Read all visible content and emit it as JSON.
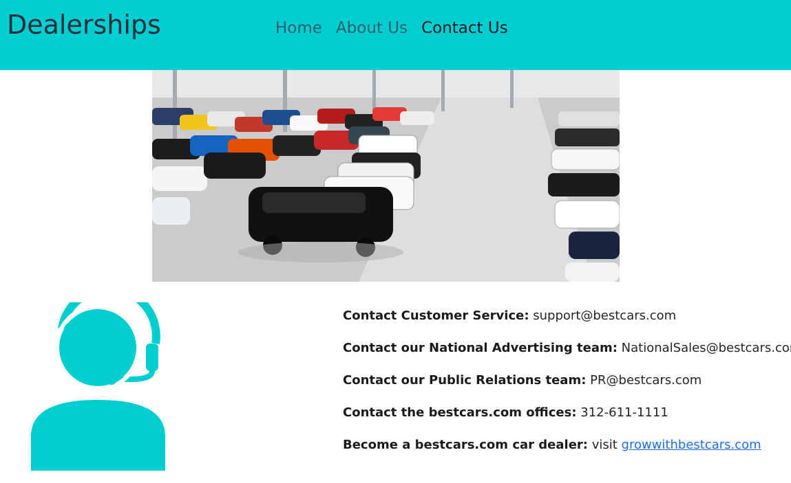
{
  "navbar": {
    "brand": "Dealerships",
    "links": [
      {
        "label": "Home",
        "active": false
      },
      {
        "label": "About Us",
        "active": false
      },
      {
        "label": "Contact Us",
        "active": true
      }
    ],
    "background_color": "#00ced1"
  },
  "hero": {
    "description": "Indoor car dealership lot photograph"
  },
  "support_icon": {
    "name": "customer-support-headset-icon",
    "color": "#00ced1"
  },
  "contacts": [
    {
      "label": "Contact Customer Service:",
      "value": "support@bestcars.com"
    },
    {
      "label": "Contact our National Advertising team:",
      "value": "NationalSales@bestcars.com"
    },
    {
      "label": "Contact our Public Relations team:",
      "value": "PR@bestcars.com"
    },
    {
      "label": "Contact the bestcars.com offices:",
      "value": "312-611-1111"
    },
    {
      "label": "Become a bestcars.com car dealer:",
      "value": "visit",
      "link_text": "growwithbestcars.com"
    }
  ]
}
